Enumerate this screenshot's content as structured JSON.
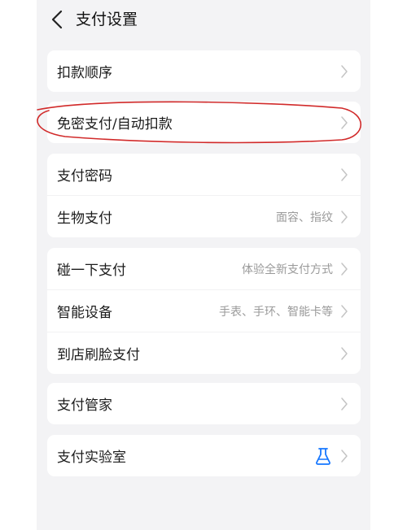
{
  "header": {
    "title": "支付设置"
  },
  "groups": [
    {
      "items": [
        {
          "label": "扣款顺序"
        }
      ]
    },
    {
      "items": [
        {
          "label": "免密支付/自动扣款"
        }
      ]
    },
    {
      "items": [
        {
          "label": "支付密码"
        },
        {
          "label": "生物支付",
          "hint": "面容、指纹"
        }
      ]
    },
    {
      "items": [
        {
          "label": "碰一下支付",
          "hint": "体验全新支付方式"
        },
        {
          "label": "智能设备",
          "hint": "手表、手环、智能卡等"
        },
        {
          "label": "到店刷脸支付"
        }
      ]
    },
    {
      "items": [
        {
          "label": "支付管家"
        }
      ]
    },
    {
      "items": [
        {
          "label": "支付实验室",
          "icon": "flask-icon"
        }
      ]
    }
  ],
  "colors": {
    "accent": "#1677ff",
    "annotation": "#d12a2a",
    "chevron": "#c4c4c4",
    "hint": "#9a9a9a"
  }
}
